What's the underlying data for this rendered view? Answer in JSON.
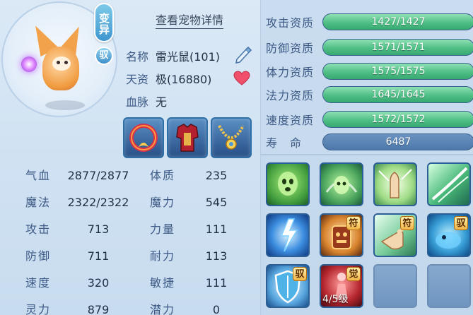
{
  "pet": {
    "mutation_badge": "变异",
    "tamed_badge": "驭",
    "detail_link": "查看宠物详情",
    "name_label": "名称",
    "name_value": "雷光鼠(101)",
    "talent_label": "天资",
    "talent_value": "极(16880)",
    "bloodline_label": "血脉",
    "bloodline_value": "无"
  },
  "equipment": [
    {
      "name": "ring-fire-red"
    },
    {
      "name": "armor-red"
    },
    {
      "name": "necklace-gold"
    }
  ],
  "stats": {
    "hp_label": "气血",
    "hp_value": "2877/2877",
    "mp_label": "魔法",
    "mp_value": "2322/2322",
    "atk_label": "攻击",
    "atk_value": "713",
    "def_label": "防御",
    "def_value": "711",
    "spd_label": "速度",
    "spd_value": "320",
    "spirit_label": "灵力",
    "spirit_value": "879",
    "con_label": "体质",
    "con_value": "235",
    "mag_label": "魔力",
    "mag_value": "545",
    "str_label": "力量",
    "str_value": "111",
    "end_label": "耐力",
    "end_value": "113",
    "agi_label": "敏捷",
    "agi_value": "111",
    "pot_label": "潜力",
    "pot_value": "0"
  },
  "aptitudes": [
    {
      "label": "攻击资质",
      "value": "1427/1427",
      "fraction": 1.0
    },
    {
      "label": "防御资质",
      "value": "1571/1571",
      "fraction": 1.0
    },
    {
      "label": "体力资质",
      "value": "1575/1575",
      "fraction": 1.0
    },
    {
      "label": "法力资质",
      "value": "1645/1645",
      "fraction": 1.0
    },
    {
      "label": "速度资质",
      "value": "1572/1572",
      "fraction": 1.0
    }
  ],
  "life": {
    "label": "寿　命",
    "value": "6487"
  },
  "skills": {
    "tag_fu": "符",
    "tag_yu": "驭",
    "tag_jue": "觉",
    "awaken_level": "4/5级"
  }
}
